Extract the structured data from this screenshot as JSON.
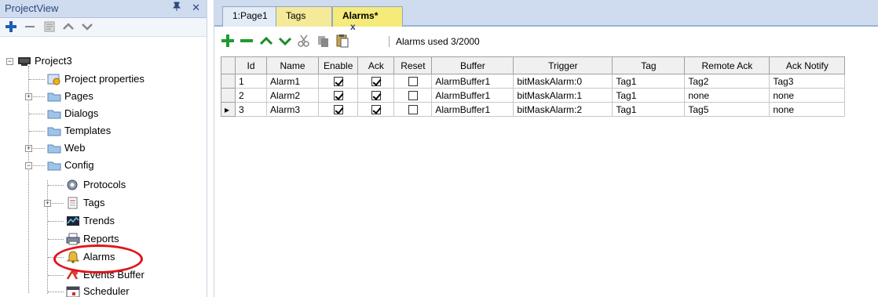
{
  "project_view": {
    "title": "ProjectView",
    "pin_symbol": "⚀",
    "close_symbol": "✕",
    "toolbar": [
      "add-icon",
      "remove-icon",
      "properties-icon",
      "move-up-icon",
      "move-down-icon"
    ],
    "tree": [
      {
        "label": "Project3",
        "icon": "monitor-icon",
        "expander": "−"
      },
      {
        "label": "Project properties",
        "icon": "properties-icon"
      },
      {
        "label": "Pages",
        "icon": "folder-icon",
        "expander": "+"
      },
      {
        "label": "Dialogs",
        "icon": "folder-icon"
      },
      {
        "label": "Templates",
        "icon": "folder-icon"
      },
      {
        "label": "Web",
        "icon": "folder-icon",
        "expander": "+"
      },
      {
        "label": "Config",
        "icon": "folder-icon",
        "expander": "−"
      },
      {
        "label": "Protocols",
        "icon": "protocols-icon"
      },
      {
        "label": "Tags",
        "icon": "tags-icon",
        "expander": "+"
      },
      {
        "label": "Trends",
        "icon": "trends-icon"
      },
      {
        "label": "Reports",
        "icon": "printer-icon"
      },
      {
        "label": "Alarms",
        "icon": "bell-icon"
      },
      {
        "label": "Events Buffer",
        "icon": "events-buffer-icon"
      },
      {
        "label": "Scheduler",
        "icon": "scheduler-icon"
      }
    ]
  },
  "tabs": [
    {
      "label": "1:Page1"
    },
    {
      "label": "Tags"
    },
    {
      "label": "Alarms*",
      "close": "x",
      "active": true
    }
  ],
  "alarm_toolbar": {
    "icons": [
      "add-icon",
      "remove-icon",
      "move-up-icon",
      "move-down-icon",
      "cut-icon",
      "copy-icon",
      "paste-icon"
    ],
    "status": "Alarms used 3/2000"
  },
  "grid": {
    "columns": [
      "Id",
      "Name",
      "Enable",
      "Ack",
      "Reset",
      "Buffer",
      "Trigger",
      "Tag",
      "Remote Ack",
      "Ack Notify"
    ],
    "rows": [
      {
        "marker": "",
        "id": "1",
        "name": "Alarm1",
        "enable": true,
        "ack": true,
        "reset": false,
        "buffer": "AlarmBuffer1",
        "trigger": "bitMaskAlarm:0",
        "tag": "Tag1",
        "remote_ack": "Tag2",
        "ack_notify": "Tag3"
      },
      {
        "marker": "",
        "id": "2",
        "name": "Alarm2",
        "enable": true,
        "ack": true,
        "reset": false,
        "buffer": "AlarmBuffer1",
        "trigger": "bitMaskAlarm:1",
        "tag": "Tag1",
        "remote_ack": "none",
        "ack_notify": "none"
      },
      {
        "marker": "▸",
        "id": "3",
        "name": "Alarm3",
        "enable": true,
        "ack": true,
        "reset": false,
        "buffer": "AlarmBuffer1",
        "trigger": "bitMaskAlarm:2",
        "tag": "Tag1",
        "remote_ack": "Tag5",
        "ack_notify": "none"
      }
    ]
  },
  "colors": {
    "panel_header": "#cfdbee",
    "active_tab": "#f5ea7a",
    "add_green": "#1f9a2f",
    "remove_green": "#1f9a2f",
    "highlight_red": "#e0141a"
  }
}
